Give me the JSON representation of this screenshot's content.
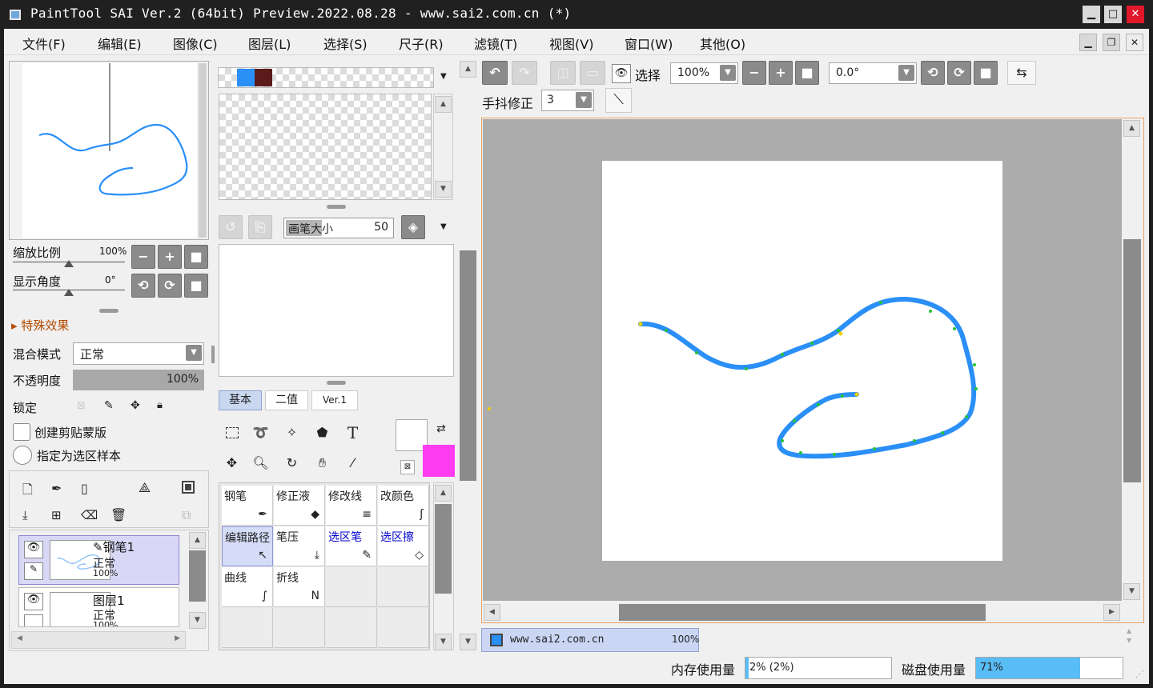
{
  "window": {
    "title": "PaintTool SAI Ver.2 (64bit) Preview.2022.08.28 - www.sai2.com.cn (*)"
  },
  "menu": [
    "文件(F)",
    "编辑(E)",
    "图像(C)",
    "图层(L)",
    "选择(S)",
    "尺子(R)",
    "滤镜(T)",
    "视图(V)",
    "窗口(W)",
    "其他(O)"
  ],
  "navigator": {
    "zoom_label": "缩放比例",
    "zoom_value": "100%",
    "angle_label": "显示角度",
    "angle_value": "0°"
  },
  "effects": {
    "label": "特殊效果"
  },
  "layer_props": {
    "blend_label": "混合模式",
    "blend_value": "正常",
    "opacity_label": "不透明度",
    "opacity_value": "100%",
    "opacity_fill": 1.0,
    "lock_label": "锁定",
    "clip_label": "创建剪贴蒙版",
    "sample_label": "指定为选区样本"
  },
  "layers": [
    {
      "name": "钢笔1",
      "mode": "正常",
      "opacity": "100%",
      "selected": true
    },
    {
      "name": "图层1",
      "mode": "正常",
      "opacity": "100%",
      "selected": false
    }
  ],
  "brush": {
    "size_label": "画笔大小",
    "size_value": "50"
  },
  "tool_tabs": [
    "基本",
    "二值",
    "Ver.1"
  ],
  "colors": {
    "swatch1": "#2a8ff7",
    "swatch2": "#5c1a1a",
    "primary": "#ffffff",
    "secondary": "#ff3cf0",
    "accent": "#2a8ff7"
  },
  "pen_tools": [
    {
      "label": "钢笔",
      "icon": "pen-icon",
      "blue": false,
      "selected": false
    },
    {
      "label": "修正液",
      "icon": "eraser-icon",
      "blue": false,
      "selected": false
    },
    {
      "label": "修改线",
      "icon": "lines-icon",
      "blue": false,
      "selected": false
    },
    {
      "label": "改颜色",
      "icon": "recolor-icon",
      "blue": false,
      "selected": false
    },
    {
      "label": "编辑路径",
      "icon": "cursor-icon",
      "blue": false,
      "selected": true
    },
    {
      "label": "笔压",
      "icon": "pressure-icon",
      "blue": false,
      "selected": false
    },
    {
      "label": "选区笔",
      "icon": "select-pen-icon",
      "blue": true,
      "selected": false
    },
    {
      "label": "选区擦",
      "icon": "select-eraser-icon",
      "blue": true,
      "selected": false
    },
    {
      "label": "曲线",
      "icon": "curve-icon",
      "blue": false,
      "selected": false
    },
    {
      "label": "折线",
      "icon": "polyline-icon",
      "blue": false,
      "selected": false
    }
  ],
  "toolbar": {
    "select_label": "选择",
    "zoom_value": "100%",
    "angle_value": "0.0°",
    "stab_label": "手抖修正",
    "stab_value": "3"
  },
  "document_tab": {
    "name": "www.sai2.com.cn",
    "zoom": "100%"
  },
  "status": {
    "mem_label": "内存使用量",
    "mem_value": "2% (2%)",
    "mem_fill": 0.02,
    "disk_label": "磁盘使用量",
    "disk_value": "71%",
    "disk_fill": 0.71
  }
}
